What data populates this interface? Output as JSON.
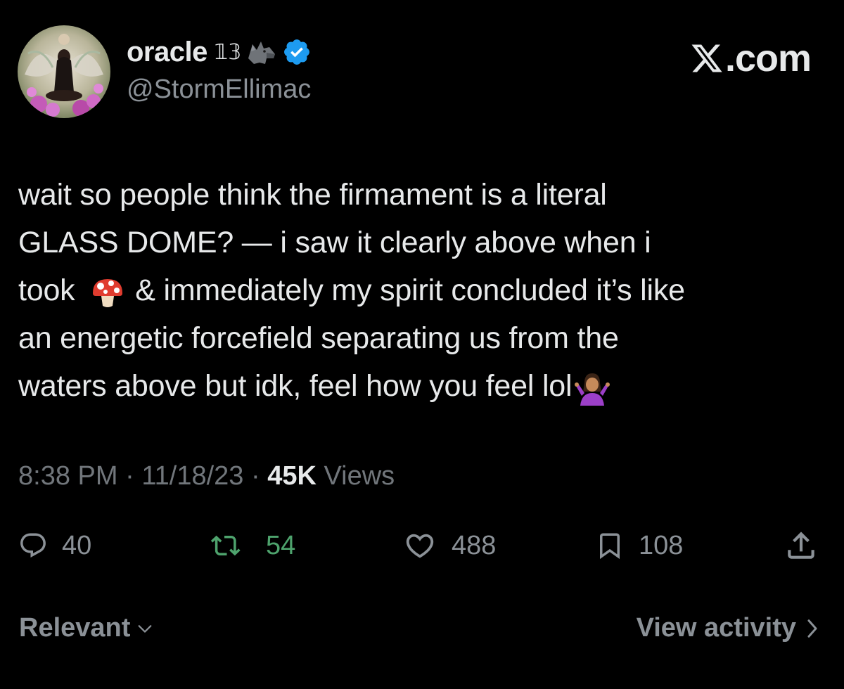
{
  "author": {
    "display_name": "oracle",
    "name_suffix": "𝟙𝟛",
    "handle": "@StormEllimac",
    "verified": true,
    "name_emoji": "wolf-icon"
  },
  "brand": {
    "label": ".com"
  },
  "tweet": {
    "lines": [
      "wait so people think the firmament is a literal",
      "GLASS DOME? — i saw it clearly above when i",
      "& immediately my spirit concluded it’s like",
      "an energetic forcefield separating us from the",
      "waters above but idk, feel how you feel lol"
    ],
    "line3_prefix": "took"
  },
  "meta": {
    "time": "8:38 PM",
    "separator": "·",
    "date": "11/18/23",
    "views_count": "45K",
    "views_label": "Views"
  },
  "actions": {
    "replies": "40",
    "reposts": "54",
    "likes": "488",
    "bookmarks": "108"
  },
  "footer": {
    "sort_label": "Relevant",
    "activity_label": "View activity"
  },
  "colors": {
    "background": "#000000",
    "text": "#e7e9ea",
    "muted": "#71767b",
    "repost_green": "#4ea36d",
    "verified_blue": "#1d9bf0"
  }
}
